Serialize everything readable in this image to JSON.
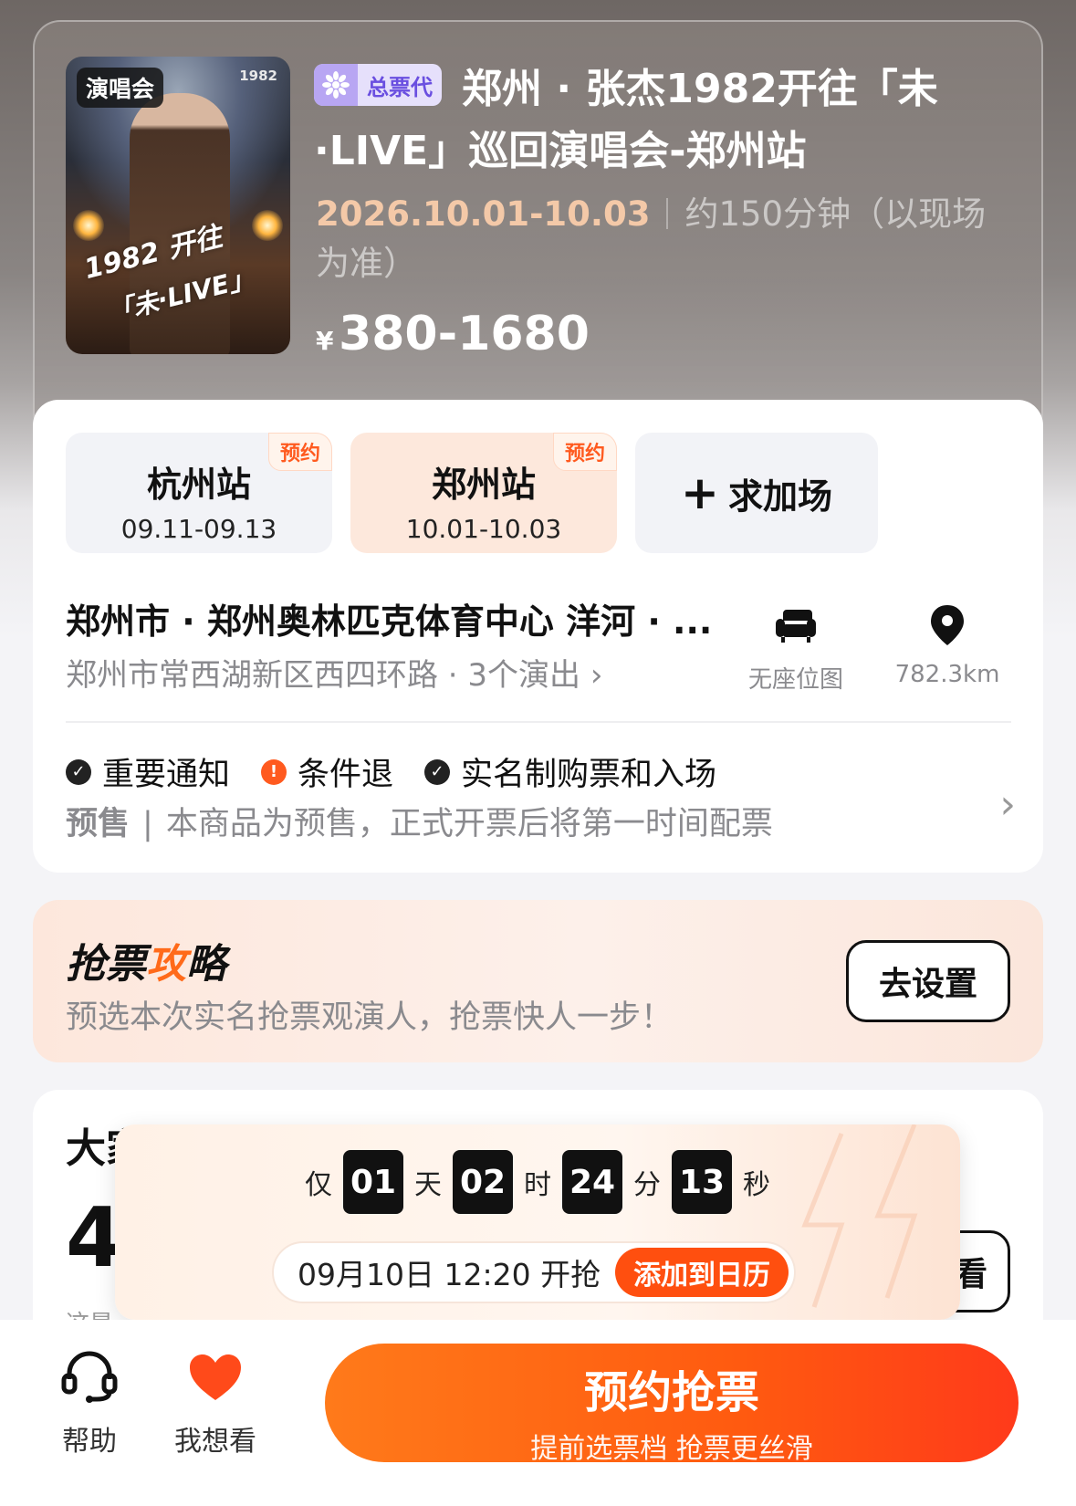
{
  "header": {
    "poster_tag": "演唱会",
    "poster_year": "1982",
    "poster_art_line1": "1982 开往",
    "poster_art_line2": "「未·LIVE」",
    "badge": "总票代",
    "title": "郑州 · 张杰1982开往「未·LIVE」巡回演唱会-郑州站",
    "date": "2026.10.01-10.03",
    "duration": "约150分钟（以现场为准）",
    "price_currency": "¥",
    "price_range": "380-1680"
  },
  "stations": [
    {
      "name": "杭州站",
      "date": "09.11-09.13",
      "tag": "预约"
    },
    {
      "name": "郑州站",
      "date": "10.01-10.03",
      "tag": "预约"
    }
  ],
  "add_session": {
    "plus": "+",
    "label": "求加场"
  },
  "venue": {
    "title": "郑州市 · 郑州奥林匹克体育中心 洋河 · ...",
    "address": "郑州市常西湖新区西四环路 · 3个演出 ›",
    "seat_map": "无座位图",
    "distance": "782.3km"
  },
  "notices": {
    "items": [
      {
        "label": "重要通知",
        "color": "#222222"
      },
      {
        "label": "条件退",
        "color": "#ff5a1f"
      },
      {
        "label": "实名制购票和入场",
        "color": "#222222"
      }
    ],
    "presale_label": "预售",
    "presale_sep": "|",
    "presale_text": "本商品为预售，正式开票后将第一时间配票"
  },
  "strategy": {
    "title_a": "抢票",
    "title_b": "攻",
    "title_c": "略",
    "subtitle": "预选本次实名抢票观演人，抢票快人一步！",
    "button": "去设置"
  },
  "lower_card": {
    "title": "大家在看",
    "big": "4",
    "small": "这是...",
    "button": "看"
  },
  "countdown": {
    "prefix": "仅",
    "days": "01",
    "days_unit": "天",
    "hours": "02",
    "hours_unit": "时",
    "minutes": "24",
    "minutes_unit": "分",
    "seconds": "13",
    "seconds_unit": "秒",
    "open_time": "09月10日 12:20 开抢",
    "calendar_button": "添加到日历"
  },
  "bottom_bar": {
    "help": "帮助",
    "want": "我想看",
    "cta_main": "预约抢票",
    "cta_sub": "提前选票档 抢票更丝滑"
  },
  "colors": {
    "accent": "#ff5a1f",
    "badge_bg": "#e6e0fb",
    "badge_text": "#6a4fe0",
    "date_highlight": "#f4c9a8"
  }
}
